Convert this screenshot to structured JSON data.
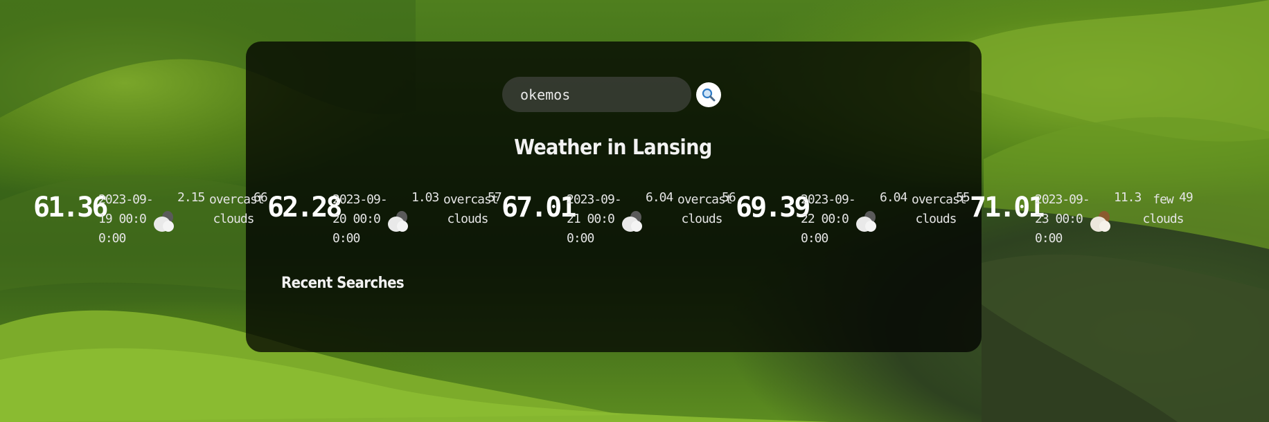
{
  "search": {
    "value": "okemos",
    "button_icon": "search-icon"
  },
  "weather": {
    "title": "Weather in Lansing",
    "days": [
      {
        "temp": "61.36",
        "date": "2023-09-19 00:00:00",
        "wind": "2.15",
        "desc": "overcast clouds",
        "humidity": "66",
        "icon": "overcast-clouds-icon"
      },
      {
        "temp": "62.28",
        "date": "2023-09-20 00:00:00",
        "wind": "1.03",
        "desc": "overcast clouds",
        "humidity": "57",
        "icon": "overcast-clouds-icon"
      },
      {
        "temp": "67.01",
        "date": "2023-09-21 00:00:00",
        "wind": "6.04",
        "desc": "overcast clouds",
        "humidity": "56",
        "icon": "overcast-clouds-icon"
      },
      {
        "temp": "69.39",
        "date": "2023-09-22 00:00:00",
        "wind": "6.04",
        "desc": "overcast clouds",
        "humidity": "55",
        "icon": "overcast-clouds-icon"
      },
      {
        "temp": "71.01",
        "date": "2023-09-23 00:00:00",
        "wind": "11.3",
        "desc": "few clouds",
        "humidity": "49",
        "icon": "few-clouds-icon"
      }
    ]
  },
  "recent": {
    "heading": "Recent Searches"
  }
}
